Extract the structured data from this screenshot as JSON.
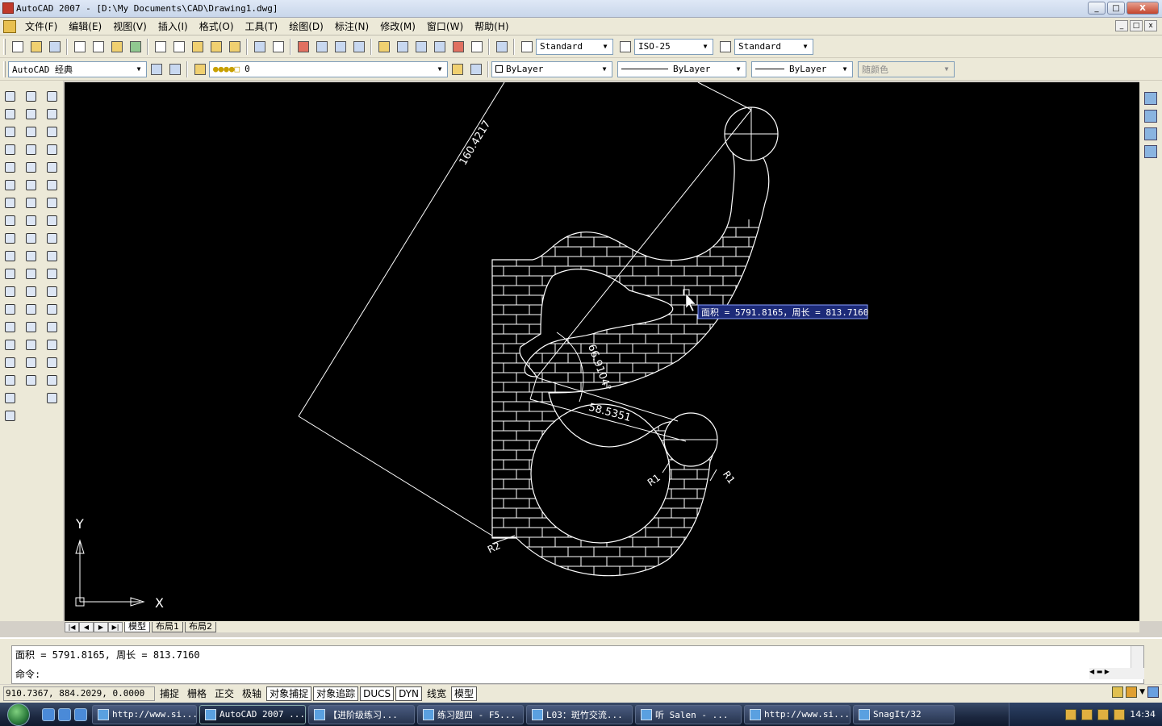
{
  "window": {
    "title": "AutoCAD 2007 - [D:\\My Documents\\CAD\\Drawing1.dwg]",
    "controls": [
      "_",
      "□",
      "X"
    ]
  },
  "menu": [
    "文件(F)",
    "编辑(E)",
    "视图(V)",
    "插入(I)",
    "格式(O)",
    "工具(T)",
    "绘图(D)",
    "标注(N)",
    "修改(M)",
    "窗口(W)",
    "帮助(H)"
  ],
  "toolbar1": {
    "text_style": "Standard",
    "dim_style": "ISO-25",
    "table_style": "Standard"
  },
  "toolbar2": {
    "workspace": "AutoCAD 经典",
    "layer": "0",
    "color": "ByLayer",
    "linetype": "ByLayer",
    "lineweight": "ByLayer",
    "plotstyle": "随颜色"
  },
  "drawing": {
    "dim_aligned": "160.4217",
    "dim_angle": "66.9104°",
    "dim_linear": "58.5351",
    "radius_1": "R1",
    "radius_2": "R1",
    "radius_3": "R2",
    "tooltip": "面积 = 5791.8165，周长 = 813.7160",
    "ucs_x": "X",
    "ucs_y": "Y"
  },
  "tabs": {
    "model": "模型",
    "layout1": "布局1",
    "layout2": "布局2"
  },
  "command": {
    "history": "面积 = 5791.8165,  周长 = 813.7160",
    "prompt": "命令:"
  },
  "status": {
    "coords": "910.7367, 884.2029, 0.0000",
    "buttons": [
      {
        "label": "捕捉",
        "on": false
      },
      {
        "label": "栅格",
        "on": false
      },
      {
        "label": "正交",
        "on": false
      },
      {
        "label": "极轴",
        "on": false
      },
      {
        "label": "对象捕捉",
        "on": true
      },
      {
        "label": "对象追踪",
        "on": true
      },
      {
        "label": "DUCS",
        "on": true
      },
      {
        "label": "DYN",
        "on": true
      },
      {
        "label": "线宽",
        "on": false
      },
      {
        "label": "模型",
        "on": true
      }
    ]
  },
  "taskbar": {
    "tasks": [
      "http://www.si...",
      "AutoCAD 2007 ...",
      "【进阶级练习...",
      "练习题四 - F5...",
      "L03：斑竹交流...",
      "听  Salen - ...",
      "http://www.si...",
      "SnagIt/32"
    ],
    "clock": "14:34"
  }
}
